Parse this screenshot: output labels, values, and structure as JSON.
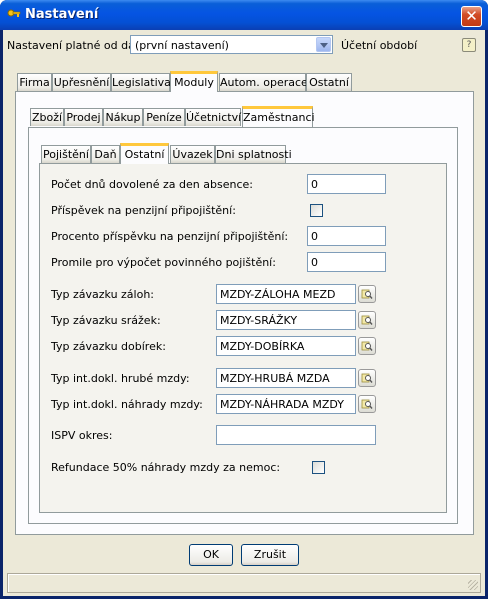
{
  "window": {
    "title": "Nastavení",
    "close_glyph": "✕"
  },
  "top": {
    "valid_from_label": "Nastavení platné od data:",
    "valid_from_value": "(první nastavení)",
    "accounting_period_label": "Účetní období",
    "help_glyph": "?"
  },
  "main_tabs": [
    "Firma",
    "Upřesnění",
    "Legislativa",
    "Moduly",
    "Autom. operace",
    "Ostatní"
  ],
  "module_tabs": [
    "Zboží",
    "Prodej",
    "Nákup",
    "Peníze",
    "Účetnictví",
    "Zaměstnanci"
  ],
  "employee_tabs": [
    "Pojištění",
    "Daň",
    "Ostatní",
    "Úvazek",
    "Dni splatnosti"
  ],
  "active": {
    "main_tab": "Moduly",
    "module_tab": "Zaměstnanci",
    "employee_tab": "Ostatní"
  },
  "fields": {
    "vacation_days": {
      "label": "Počet dnů dovolené za den absence:",
      "value": "0"
    },
    "pension_contribution": {
      "label": "Příspěvek na penzijní připojištění:",
      "checked": false
    },
    "pension_percent": {
      "label": "Procento příspěvku na penzijní připojištění:",
      "value": "0"
    },
    "mandatory_insurance": {
      "label": "Promile pro výpočet povinného pojištění:",
      "value": "0"
    },
    "advance_type": {
      "label": "Typ závazku záloh:",
      "value": "MZDY-ZÁLOHA MEZD"
    },
    "deduction_type": {
      "label": "Typ závazku srážek:",
      "value": "MZDY-SRÁŽKY"
    },
    "dobirka_type": {
      "label": "Typ závazku dobírek:",
      "value": "MZDY-DOBÍRKA"
    },
    "gross_wage_doc": {
      "label": "Typ int.dokl. hrubé mzdy:",
      "value": "MZDY-HRUBÁ MZDA"
    },
    "wage_compensation_doc": {
      "label": "Typ int.dokl. náhrady mzdy:",
      "value": "MZDY-NÁHRADA MZDY"
    },
    "ispv_district": {
      "label": "ISPV okres:",
      "value": ""
    },
    "refund_50": {
      "label": "Refundace 50% náhrady mzdy za nemoc:",
      "checked": false
    }
  },
  "buttons": {
    "ok": "OK",
    "cancel": "Zrušit"
  },
  "colors": {
    "title_bar": "#0554e3",
    "dialog_bg": "#ece9d8",
    "active_tab_accent": "#ffc83c"
  }
}
